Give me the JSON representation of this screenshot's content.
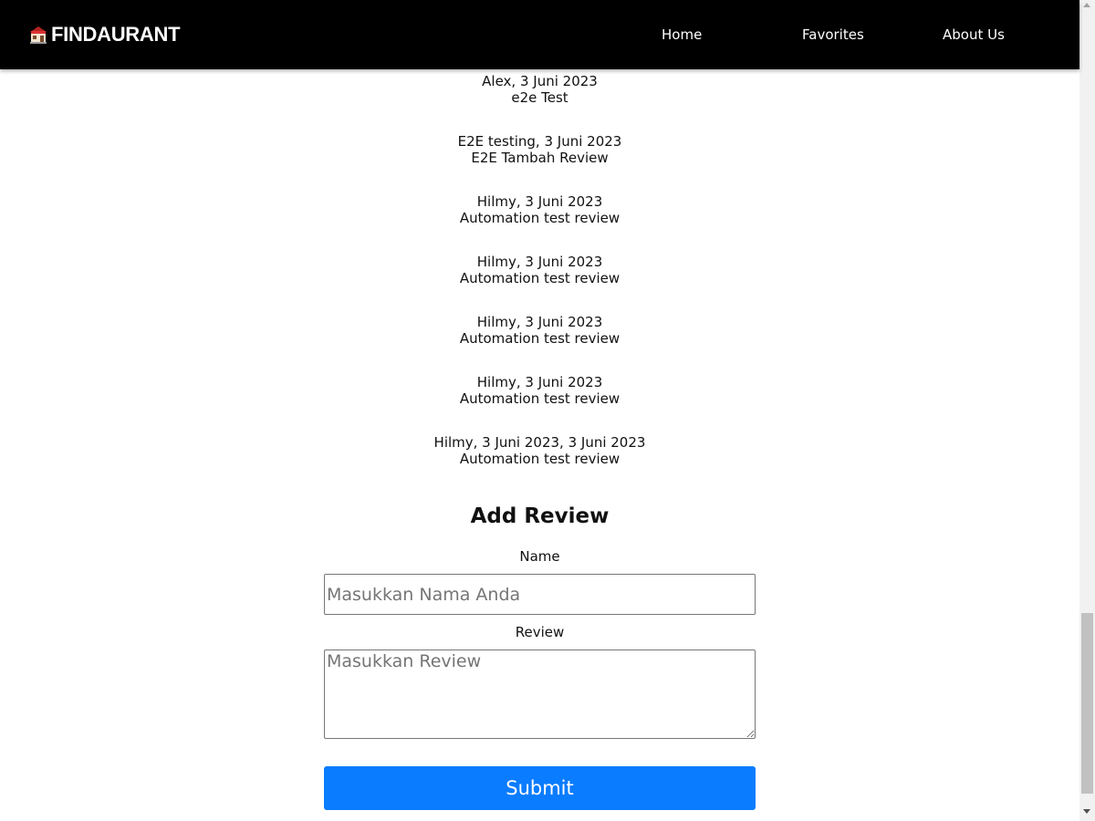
{
  "header": {
    "brand_name": "FINDAURANT",
    "brand_icon": "restaurant-icon",
    "nav": [
      {
        "label": "Home"
      },
      {
        "label": "Favorites"
      },
      {
        "label": "About Us"
      }
    ],
    "background": "#000000"
  },
  "reviews": [
    {
      "meta": "Alex, 3 Juni 2023",
      "text": "e2e Test"
    },
    {
      "meta": "E2E testing, 3 Juni 2023",
      "text": "E2E Tambah Review"
    },
    {
      "meta": "Hilmy, 3 Juni 2023",
      "text": "Automation test review"
    },
    {
      "meta": "Hilmy, 3 Juni 2023",
      "text": "Automation test review"
    },
    {
      "meta": "Hilmy, 3 Juni 2023",
      "text": "Automation test review"
    },
    {
      "meta": "Hilmy, 3 Juni 2023",
      "text": "Automation test review"
    },
    {
      "meta": "Hilmy, 3 Juni 2023, 3 Juni 2023",
      "text": "Automation test review"
    }
  ],
  "form": {
    "title": "Add Review",
    "name_label": "Name",
    "name_placeholder": "Masukkan Nama Anda",
    "name_value": "",
    "review_label": "Review",
    "review_placeholder": "Masukkan Review",
    "review_value": "",
    "submit_label": "Submit",
    "submit_color": "#0a7cff"
  }
}
